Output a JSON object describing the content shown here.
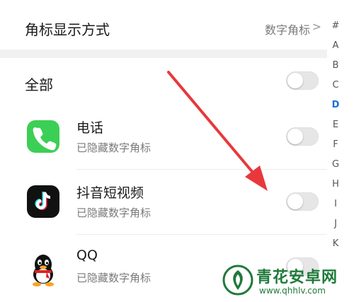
{
  "badge_setting": {
    "title": "角标显示方式",
    "value": "数字角标",
    "chevron": ">"
  },
  "all_row": {
    "label": "全部",
    "toggle_on": false
  },
  "apps": [
    {
      "name": "电话",
      "subtitle": "已隐藏数字角标",
      "icon": "phone-app-icon",
      "toggle_on": false
    },
    {
      "name": "抖音短视频",
      "subtitle": "已隐藏数字角标",
      "icon": "douyin-app-icon",
      "toggle_on": false
    },
    {
      "name": "QQ",
      "subtitle": "已隐藏数字角标",
      "icon": "qq-app-icon",
      "toggle_on": false
    }
  ],
  "index_letters": [
    "#",
    "A",
    "B",
    "C",
    "D",
    "E",
    "F",
    "G",
    "H",
    "I",
    "J",
    "K"
  ],
  "index_active": "D",
  "watermark": {
    "title": "青花安卓网",
    "url": "www.qhhlv.com"
  },
  "colors": {
    "accent": "#1a6fd8",
    "arrow": "#e8383b",
    "phone_green": "#3ccf55",
    "douyin_bg": "#111111",
    "watermark_green": "#1f7a3a"
  }
}
